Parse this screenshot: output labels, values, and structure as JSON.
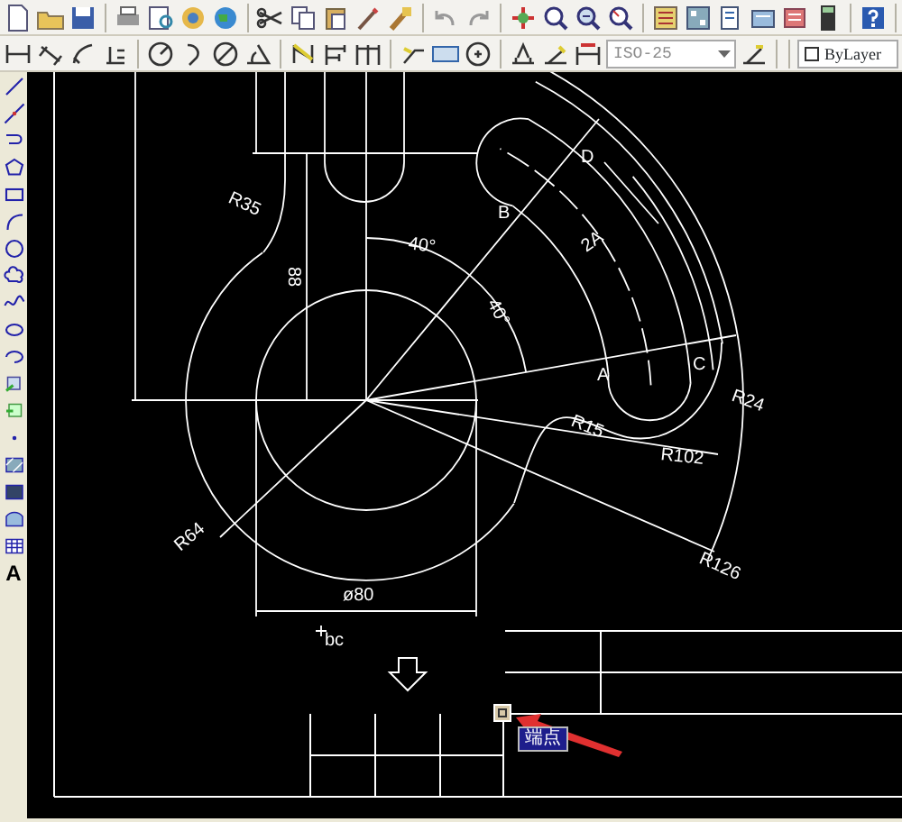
{
  "toolbars": {
    "dim_style": {
      "value": "ISO-25"
    },
    "layer_color": {
      "value": "ByLayer"
    }
  },
  "draw_toolbar": {
    "text_tool": "A"
  },
  "drawing": {
    "labels": [
      {
        "text": "R35"
      },
      {
        "text": "88"
      },
      {
        "text": "40°"
      },
      {
        "text": "40°"
      },
      {
        "text": "2A"
      },
      {
        "text": "D"
      },
      {
        "text": "B"
      },
      {
        "text": "A"
      },
      {
        "text": "C"
      },
      {
        "text": "R24"
      },
      {
        "text": "R15"
      },
      {
        "text": "R102"
      },
      {
        "text": "R64"
      },
      {
        "text": "R126"
      },
      {
        "text": "ø80"
      },
      {
        "text": "bc"
      }
    ]
  },
  "snap_tooltip": {
    "text": "端点"
  }
}
